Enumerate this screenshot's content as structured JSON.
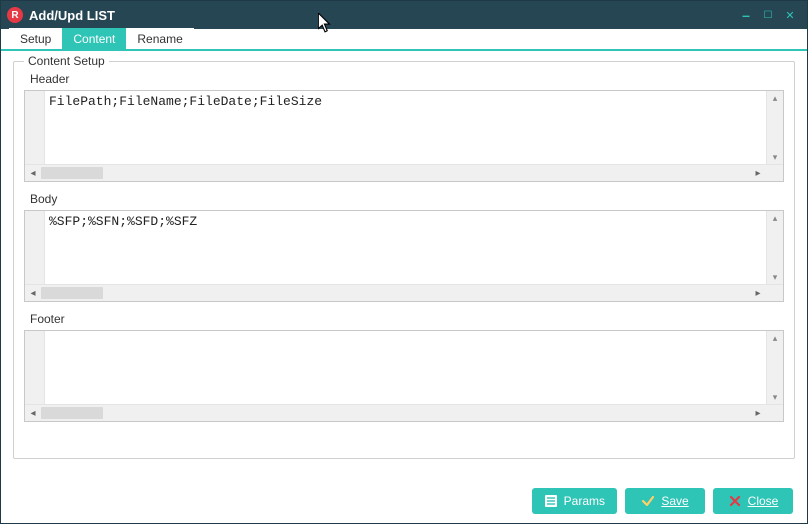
{
  "window": {
    "title": "Add/Upd LIST",
    "app_badge": "R"
  },
  "tabs": {
    "setup": "Setup",
    "content": "Content",
    "rename": "Rename",
    "active": "content"
  },
  "group": {
    "legend": "Content Setup",
    "header_label": "Header",
    "header_value": "FilePath;FileName;FileDate;FileSize",
    "body_label": "Body",
    "body_value": "%SFP;%SFN;%SFD;%SFZ",
    "footer_label": "Footer",
    "footer_value": ""
  },
  "buttons": {
    "params": "Params",
    "save": "Save",
    "close": "Close"
  }
}
